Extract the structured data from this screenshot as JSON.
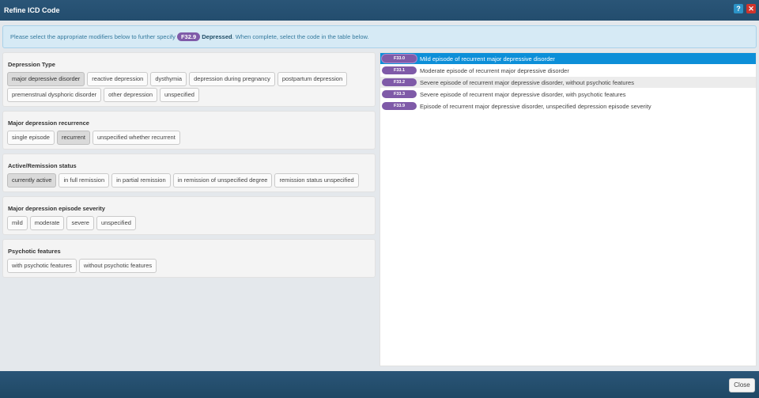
{
  "window": {
    "title": "Refine ICD Code",
    "help_glyph": "?",
    "close_glyph": "✕"
  },
  "info": {
    "prefix": "Please select the appropriate modifiers below to further specify",
    "code": "F32.9",
    "term": "Depressed",
    "suffix": ". When complete, select the code in the table below."
  },
  "groups": [
    {
      "title": "Depression Type",
      "options": [
        {
          "label": "major depressive disorder",
          "selected": true
        },
        {
          "label": "reactive depression",
          "selected": false
        },
        {
          "label": "dysthymia",
          "selected": false
        },
        {
          "label": "depression during pregnancy",
          "selected": false
        },
        {
          "label": "postpartum depression",
          "selected": false
        },
        {
          "label": "premenstrual dysphoric disorder",
          "selected": false
        },
        {
          "label": "other depression",
          "selected": false
        },
        {
          "label": "unspecified",
          "selected": false
        }
      ]
    },
    {
      "title": "Major depression recurrence",
      "options": [
        {
          "label": "single episode",
          "selected": false
        },
        {
          "label": "recurrent",
          "selected": true
        },
        {
          "label": "unspecified whether recurrent",
          "selected": false
        }
      ]
    },
    {
      "title": "Active/Remission status",
      "options": [
        {
          "label": "currently active",
          "selected": true
        },
        {
          "label": "in full remission",
          "selected": false
        },
        {
          "label": "in partial remission",
          "selected": false
        },
        {
          "label": "in remission of unspecified degree",
          "selected": false
        },
        {
          "label": "remission status unspecified",
          "selected": false
        }
      ]
    },
    {
      "title": "Major depression episode severity",
      "options": [
        {
          "label": "mild",
          "selected": false
        },
        {
          "label": "moderate",
          "selected": false
        },
        {
          "label": "severe",
          "selected": false
        },
        {
          "label": "unspecified",
          "selected": false
        }
      ]
    },
    {
      "title": "Psychotic features",
      "options": [
        {
          "label": "with psychotic features",
          "selected": false
        },
        {
          "label": "without psychotic features",
          "selected": false
        }
      ]
    }
  ],
  "codes": [
    {
      "code": "F33.0",
      "description": "Mild episode of recurrent major depressive disorder",
      "active": true
    },
    {
      "code": "F33.1",
      "description": "Moderate episode of recurrent major depressive disorder",
      "active": false
    },
    {
      "code": "F33.2",
      "description": "Severe episode of recurrent major depressive disorder, without psychotic features",
      "active": false
    },
    {
      "code": "F33.3",
      "description": "Severe episode of recurrent major depressive disorder, with psychotic features",
      "active": false
    },
    {
      "code": "F33.9",
      "description": "Episode of recurrent major depressive disorder, unspecified depression episode severity",
      "active": false
    }
  ],
  "footer": {
    "close_label": "Close"
  },
  "colors": {
    "header": "#234d6e",
    "accent": "#0d8fd8",
    "code_pill": "#7f5aa8"
  }
}
